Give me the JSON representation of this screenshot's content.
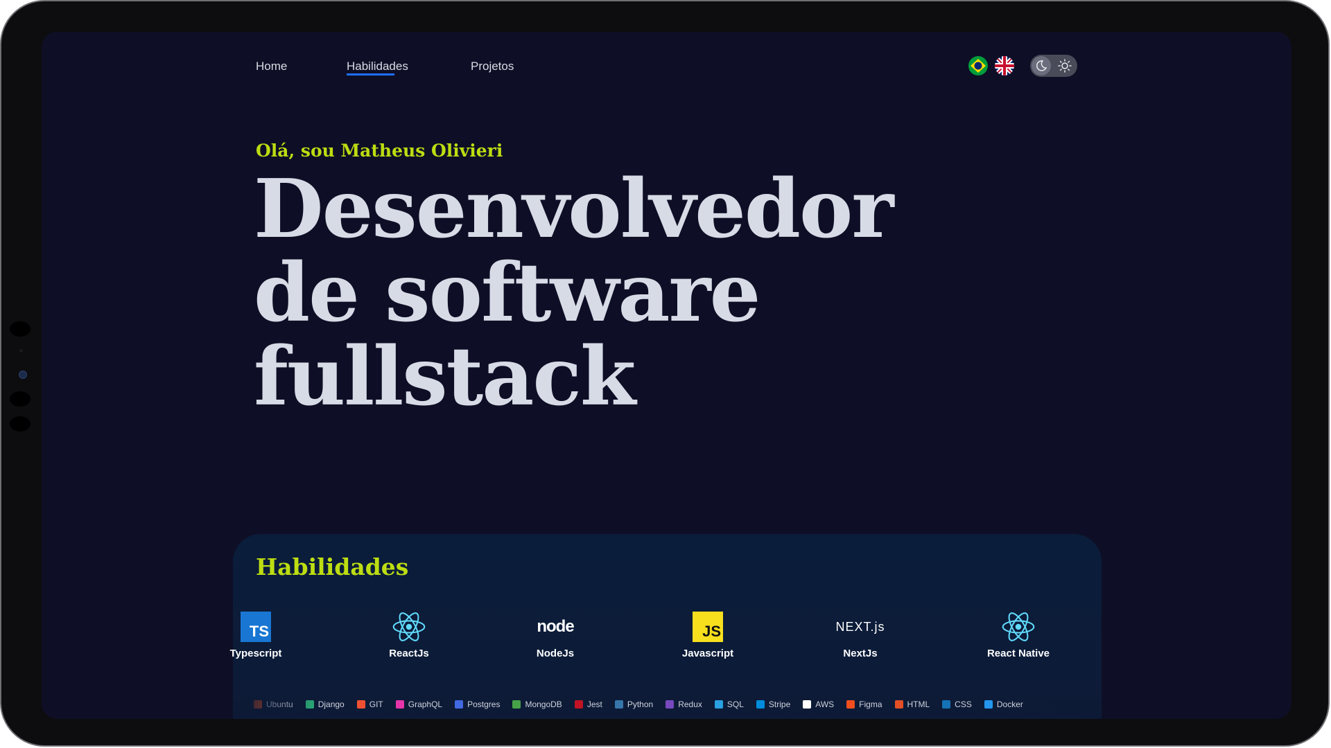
{
  "nav": {
    "items": [
      {
        "label": "Home",
        "active": false
      },
      {
        "label": "Habilidades",
        "active": true
      },
      {
        "label": "Projetos",
        "active": false
      }
    ],
    "languages": [
      {
        "name": "pt-br-flag-icon",
        "color": "#009c3b"
      },
      {
        "name": "uk-flag-icon",
        "color": "#012169"
      }
    ],
    "theme_toggle": {
      "mode": "dark",
      "icons": [
        "moon-icon",
        "sun-icon"
      ]
    }
  },
  "hero": {
    "greeting": "Olá, sou Matheus Olivieri",
    "headline_1": "Desenvolvedor",
    "headline_2": "de software",
    "headline_3": "fullstack"
  },
  "skills": {
    "title": "Habilidades",
    "items": [
      {
        "label": "Typescript",
        "icon": "typescript-icon"
      },
      {
        "label": "ReactJs",
        "icon": "react-icon"
      },
      {
        "label": "NodeJs",
        "icon": "nodejs-icon"
      },
      {
        "label": "Javascript",
        "icon": "javascript-icon"
      },
      {
        "label": "NextJs",
        "icon": "nextjs-icon"
      },
      {
        "label": "React Native",
        "icon": "react-native-icon"
      }
    ],
    "marquee": [
      {
        "label": "Ubuntu",
        "color": "#e95420"
      },
      {
        "label": "Django",
        "color": "#2ba977"
      },
      {
        "label": "GIT",
        "color": "#f05032"
      },
      {
        "label": "GraphQL",
        "color": "#e535ab"
      },
      {
        "label": "Postgres",
        "color": "#4169e1"
      },
      {
        "label": "MongoDB",
        "color": "#47a248"
      },
      {
        "label": "Jest",
        "color": "#c21325"
      },
      {
        "label": "Python",
        "color": "#3776ab"
      },
      {
        "label": "Redux",
        "color": "#764abc"
      },
      {
        "label": "SQL",
        "color": "#2aa1e0"
      },
      {
        "label": "Stripe",
        "color": "#008cdd"
      },
      {
        "label": "AWS",
        "color": "#ffffff"
      },
      {
        "label": "Figma",
        "color": "#f24e1e"
      },
      {
        "label": "HTML",
        "color": "#e34f26"
      },
      {
        "label": "CSS",
        "color": "#1572b6"
      },
      {
        "label": "Docker",
        "color": "#2496ed"
      }
    ]
  },
  "colors": {
    "background": "#0e0f26",
    "accent": "#bddd12",
    "headline": "#d7dbe6",
    "nav_underline": "#1f6fff",
    "skills_panel": "#0a1d3b"
  }
}
